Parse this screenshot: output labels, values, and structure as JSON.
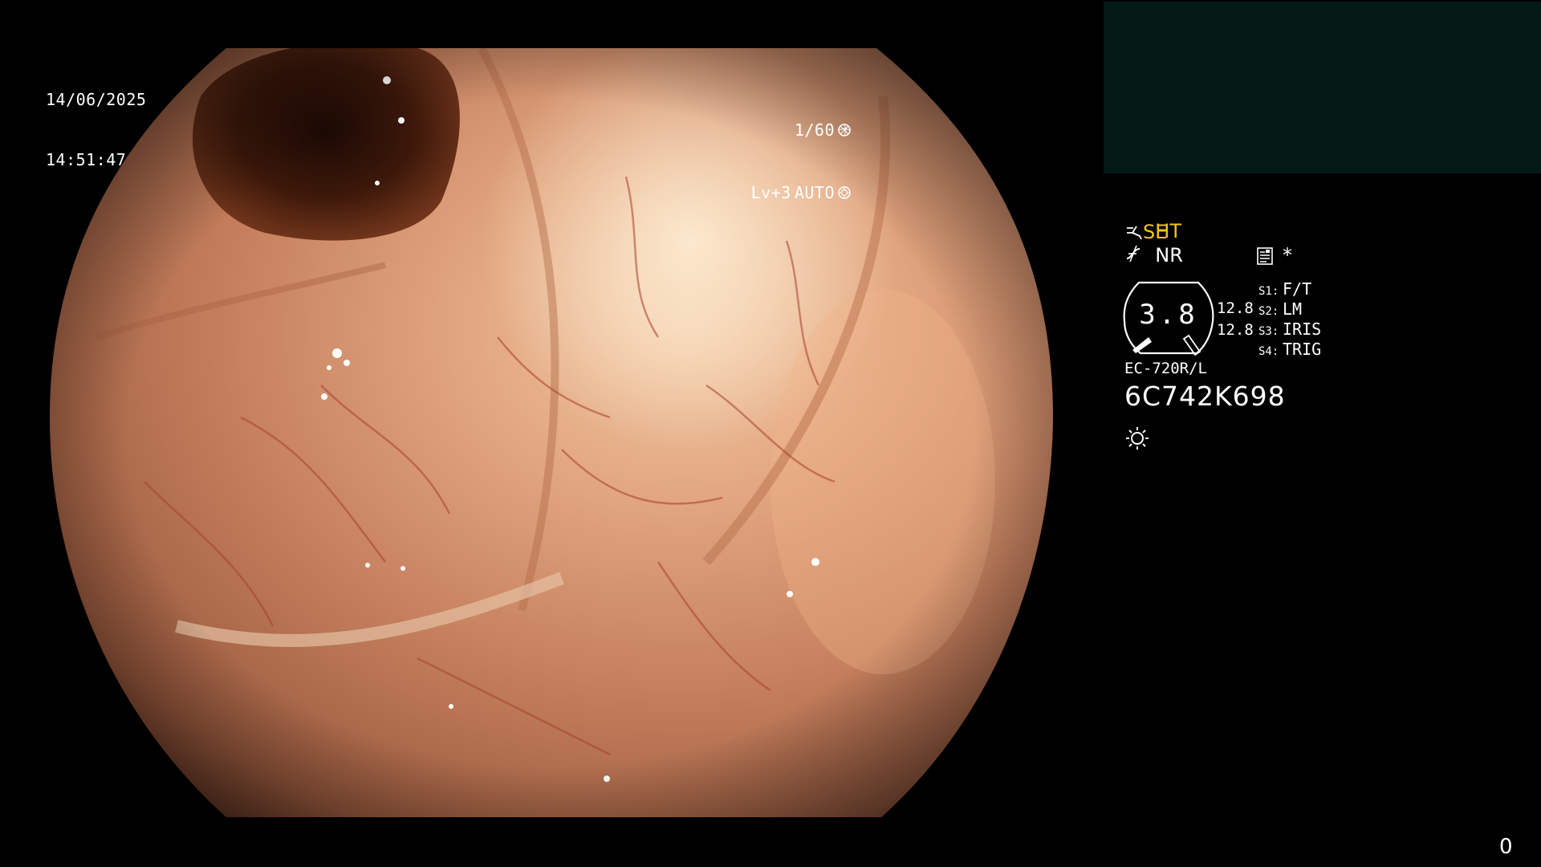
{
  "overlay": {
    "date": "14/06/2025",
    "time": "14:51:47",
    "shutter": "1/60",
    "level": "Lv+3",
    "iris_mode": "AUTO"
  },
  "panel": {
    "mode_ht": "HT",
    "mode_nr": "NR",
    "mode_se": "SE",
    "star": "*",
    "gauge_value": "3.8",
    "value_top": "12.8",
    "value_bottom": "12.8",
    "switches": [
      {
        "key": "S1:",
        "value": "F/T"
      },
      {
        "key": "S2:",
        "value": "LM"
      },
      {
        "key": "S3:",
        "value": "IRIS"
      },
      {
        "key": "S4:",
        "value": "TRIG"
      }
    ],
    "scope_model": "EC-720R/L",
    "serial": "6C742K698",
    "counter": "0"
  },
  "icons": {
    "shutter": "aperture-icon",
    "iris": "iris-icon",
    "scope_function": "function-curve-icon",
    "memo": "memo-icon",
    "light": "light-sun-icon"
  },
  "colors": {
    "accent": "#f5c518",
    "thumbnail_bg": "#041a17"
  }
}
